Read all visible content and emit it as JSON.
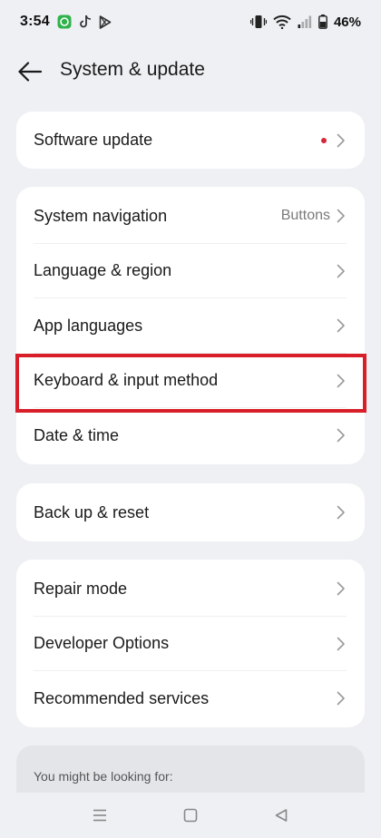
{
  "status_bar": {
    "time": "3:54",
    "battery_percent": "46%",
    "icons_left": [
      "whatsapp-style-icon",
      "tiktok-icon",
      "play-store-icon"
    ],
    "icons_right": [
      "vibrate-icon",
      "wifi-icon",
      "signal-icon",
      "battery-icon"
    ]
  },
  "header": {
    "title": "System & update"
  },
  "groups": {
    "g1": [
      {
        "label": "Software update",
        "badge": "dot",
        "badge_color": "#d6243b"
      }
    ],
    "g2": [
      {
        "label": "System navigation",
        "value": "Buttons"
      },
      {
        "label": "Language & region"
      },
      {
        "label": "App languages"
      },
      {
        "label": "Keyboard & input method",
        "highlighted": true
      },
      {
        "label": "Date & time"
      }
    ],
    "g3": [
      {
        "label": "Back up & reset"
      }
    ],
    "g4": [
      {
        "label": "Repair mode"
      },
      {
        "label": "Developer Options"
      },
      {
        "label": "Recommended services"
      }
    ]
  },
  "suggestions": {
    "label": "You might be looking for:"
  },
  "nav_bar": {
    "buttons": [
      "menu-icon",
      "home-icon",
      "back-triangle-icon"
    ]
  },
  "colors": {
    "background": "#eef0f3",
    "card": "#ffffff",
    "highlight": "#d81e28",
    "secondary_text": "#7a7a7a"
  }
}
